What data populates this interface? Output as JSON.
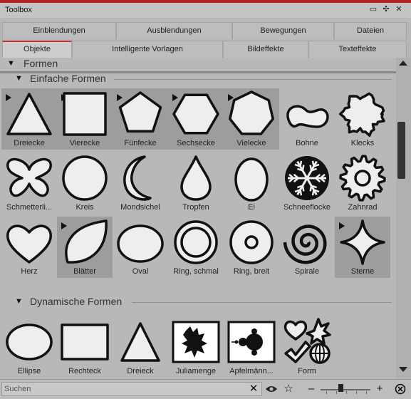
{
  "window": {
    "title": "Toolbox"
  },
  "tabs_row1": [
    {
      "label": "Einblendungen"
    },
    {
      "label": "Ausblendungen"
    },
    {
      "label": "Bewegungen"
    },
    {
      "label": "Dateien"
    }
  ],
  "tabs_row2": [
    {
      "label": "Objekte",
      "active": true
    },
    {
      "label": "Intelligente Vorlagen"
    },
    {
      "label": "Bildeffekte"
    },
    {
      "label": "Texteffekte"
    }
  ],
  "sections": {
    "formen": {
      "label": "Formen"
    },
    "einfache": {
      "label": "Einfache Formen"
    },
    "dynamische": {
      "label": "Dynamische Formen"
    }
  },
  "einfache_formen": [
    {
      "label": "Dreiecke",
      "icon": "triangle-icon",
      "selected": true
    },
    {
      "label": "Vierecke",
      "icon": "square-icon",
      "selected": true
    },
    {
      "label": "Fünfecke",
      "icon": "pentagon-icon",
      "selected": true
    },
    {
      "label": "Sechsecke",
      "icon": "hexagon-icon",
      "selected": true
    },
    {
      "label": "Vielecke",
      "icon": "heptagon-icon",
      "selected": true
    },
    {
      "label": "Bohne",
      "icon": "bean-icon"
    },
    {
      "label": "Klecks",
      "icon": "blob-icon"
    },
    {
      "label": "Schmetterli...",
      "icon": "butterfly-icon"
    },
    {
      "label": "Kreis",
      "icon": "circle-icon"
    },
    {
      "label": "Mondsichel",
      "icon": "crescent-icon"
    },
    {
      "label": "Tropfen",
      "icon": "drop-icon"
    },
    {
      "label": "Ei",
      "icon": "egg-icon"
    },
    {
      "label": "Schneeflocke",
      "icon": "snowflake-icon"
    },
    {
      "label": "Zahnrad",
      "icon": "gear-icon"
    },
    {
      "label": "Herz",
      "icon": "heart-icon"
    },
    {
      "label": "Blätter",
      "icon": "leaf-icon",
      "selected": true
    },
    {
      "label": "Oval",
      "icon": "oval-icon"
    },
    {
      "label": "Ring, schmal",
      "icon": "thin-ring-icon"
    },
    {
      "label": "Ring, breit",
      "icon": "wide-ring-icon"
    },
    {
      "label": "Spirale",
      "icon": "spiral-icon"
    },
    {
      "label": "Sterne",
      "icon": "star-icon",
      "selected": true
    }
  ],
  "dynamische_formen": [
    {
      "label": "Ellipse",
      "icon": "ellipse-icon"
    },
    {
      "label": "Rechteck",
      "icon": "rectangle-icon"
    },
    {
      "label": "Dreieck",
      "icon": "triangle-outline-icon"
    },
    {
      "label": "Juliamenge",
      "icon": "julia-set-icon"
    },
    {
      "label": "Apfelmänn...",
      "icon": "mandelbrot-icon"
    },
    {
      "label": "Form",
      "icon": "shape-collection-icon"
    }
  ],
  "search": {
    "placeholder": "Suchen",
    "value": ""
  },
  "bottombar": {
    "clear": "✕",
    "eye": "eye-icon",
    "star": "☆",
    "zoom_out": "–",
    "zoom_in": "+",
    "zoom_level": 0.4
  },
  "colors": {
    "accent": "#c73030",
    "selected_tile": "#9d9d9d",
    "background": "#b8b8b8"
  }
}
